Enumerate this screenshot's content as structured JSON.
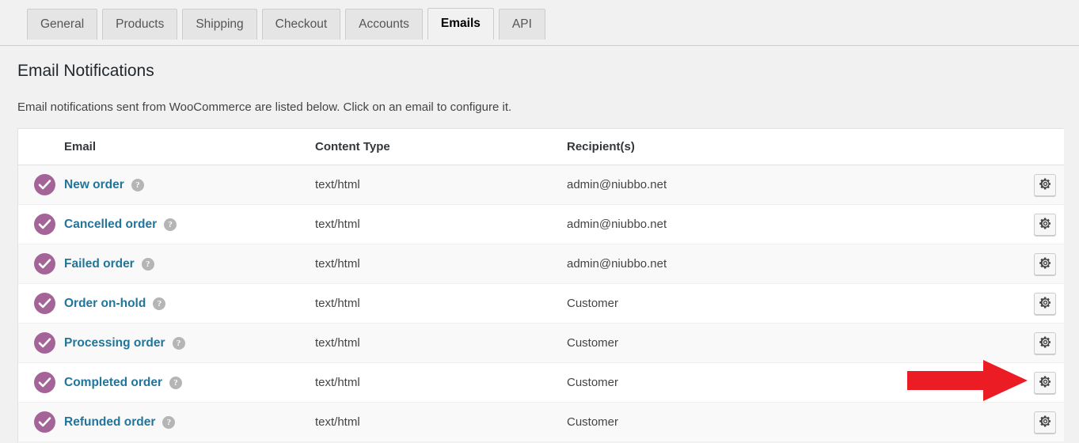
{
  "tabs": [
    {
      "label": "General",
      "active": false
    },
    {
      "label": "Products",
      "active": false
    },
    {
      "label": "Shipping",
      "active": false
    },
    {
      "label": "Checkout",
      "active": false
    },
    {
      "label": "Accounts",
      "active": false
    },
    {
      "label": "Emails",
      "active": true
    },
    {
      "label": "API",
      "active": false
    }
  ],
  "page": {
    "title": "Email Notifications",
    "description": "Email notifications sent from WooCommerce are listed below. Click on an email to configure it."
  },
  "table": {
    "columns": {
      "status": "",
      "email": "Email",
      "content_type": "Content Type",
      "recipients": "Recipient(s)",
      "actions": ""
    },
    "rows": [
      {
        "status": "enabled",
        "status_icon": "check-circle-icon",
        "name": "New order",
        "help": "?",
        "content_type": "text/html",
        "recipients": "admin@niubbo.net",
        "action_icon": "gear-icon"
      },
      {
        "status": "enabled",
        "status_icon": "check-circle-icon",
        "name": "Cancelled order",
        "help": "?",
        "content_type": "text/html",
        "recipients": "admin@niubbo.net",
        "action_icon": "gear-icon"
      },
      {
        "status": "enabled",
        "status_icon": "check-circle-icon",
        "name": "Failed order",
        "help": "?",
        "content_type": "text/html",
        "recipients": "admin@niubbo.net",
        "action_icon": "gear-icon"
      },
      {
        "status": "enabled",
        "status_icon": "check-circle-icon",
        "name": "Order on-hold",
        "help": "?",
        "content_type": "text/html",
        "recipients": "Customer",
        "action_icon": "gear-icon"
      },
      {
        "status": "enabled",
        "status_icon": "check-circle-icon",
        "name": "Processing order",
        "help": "?",
        "content_type": "text/html",
        "recipients": "Customer",
        "action_icon": "gear-icon"
      },
      {
        "status": "enabled",
        "status_icon": "check-circle-icon",
        "name": "Completed order",
        "help": "?",
        "content_type": "text/html",
        "recipients": "Customer",
        "action_icon": "gear-icon"
      },
      {
        "status": "enabled",
        "status_icon": "check-circle-icon",
        "name": "Refunded order",
        "help": "?",
        "content_type": "text/html",
        "recipients": "Customer",
        "action_icon": "gear-icon"
      }
    ]
  },
  "annotation": {
    "type": "arrow",
    "direction": "right",
    "points_at": "Completed order",
    "color": "#ec1c24"
  },
  "colors": {
    "page_background": "#f1f1f1",
    "status_enabled": "#a46497",
    "link": "#21759b",
    "annotation_red": "#ec1c24",
    "row_alt": "#f9f9f9"
  }
}
